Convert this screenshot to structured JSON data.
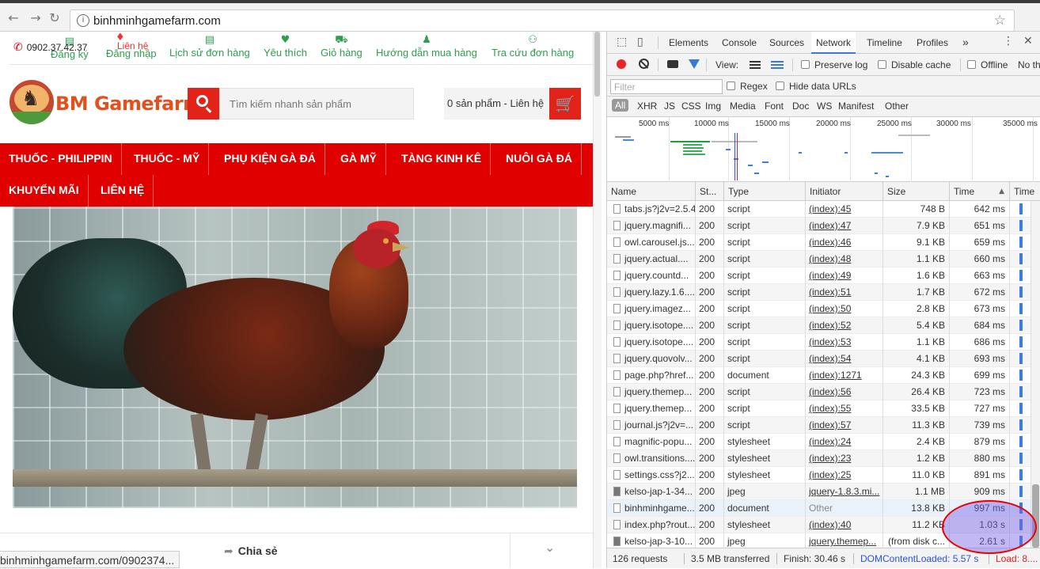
{
  "browser": {
    "url": "binhminhgamefarm.com",
    "status_url": "binhminhgamefarm.com/0902374..."
  },
  "site": {
    "phone": "0902.37.42.37",
    "top_links": [
      {
        "label": "Đăng ký",
        "icon": "file-icon"
      },
      {
        "label": "Liên hệ",
        "icon": "location-pin-icon"
      },
      {
        "label": "Đăng nhập",
        "icon": "login-icon"
      },
      {
        "label": "Lịch sử đơn hàng",
        "icon": "document-icon"
      },
      {
        "label": "Yêu thích",
        "icon": "heart-icon"
      },
      {
        "label": "Giỏ hàng",
        "icon": "cart-icon"
      },
      {
        "label": "Hướng dẫn mua hàng",
        "icon": "user-icon"
      },
      {
        "label": "Tra cứu đơn hàng",
        "icon": "binoculars-icon"
      }
    ],
    "logo_text": "BM Gamefarm",
    "search_placeholder": "Tìm kiếm nhanh sản phẩm",
    "cart_text": "0 sản phẩm - Liên hệ",
    "menu": [
      "THUỐC - PHILIPPIN",
      "THUỐC - MỸ",
      "PHỤ KIỆN GÀ ĐÁ",
      "GÀ MỸ",
      "TÀNG KINH KÊ",
      "NUÔI GÀ ĐÁ",
      "KHUYẾN MÃI",
      "LIÊN HỆ"
    ],
    "share_label": "Chia sẻ",
    "colors": {
      "brand_red": "#e00000",
      "accent_green": "#2e9e4d",
      "logo_orange": "#e2501e"
    }
  },
  "devtools": {
    "tabs": [
      "Elements",
      "Console",
      "Sources",
      "Network",
      "Timeline",
      "Profiles"
    ],
    "active_tab": "Network",
    "more": "»",
    "view_label": "View:",
    "preserve_log": "Preserve log",
    "disable_cache": "Disable cache",
    "offline": "Offline",
    "throttle": "No th",
    "filter_placeholder": "Filter",
    "regex": "Regex",
    "hide_data_urls": "Hide data URLs",
    "types": [
      "All",
      "XHR",
      "JS",
      "CSS",
      "Img",
      "Media",
      "Font",
      "Doc",
      "WS",
      "Manifest",
      "Other"
    ],
    "timeline_ticks": [
      "5000 ms",
      "10000 ms",
      "15000 ms",
      "20000 ms",
      "25000 ms",
      "30000 ms",
      "35000 ms"
    ],
    "columns": [
      "Name",
      "St...",
      "Type",
      "Initiator",
      "Size",
      "Time",
      "Time"
    ],
    "rows": [
      {
        "name": "tabs.js?j2v=2.5.4",
        "status": "200",
        "type": "script",
        "initiator": "(index):45",
        "size": "748 B",
        "time": "642 ms"
      },
      {
        "name": "jquery.magnifi...",
        "status": "200",
        "type": "script",
        "initiator": "(index):47",
        "size": "7.9 KB",
        "time": "651 ms"
      },
      {
        "name": "owl.carousel.js...",
        "status": "200",
        "type": "script",
        "initiator": "(index):46",
        "size": "9.1 KB",
        "time": "659 ms"
      },
      {
        "name": "jquery.actual....",
        "status": "200",
        "type": "script",
        "initiator": "(index):48",
        "size": "1.1 KB",
        "time": "660 ms"
      },
      {
        "name": "jquery.countd...",
        "status": "200",
        "type": "script",
        "initiator": "(index):49",
        "size": "1.6 KB",
        "time": "663 ms"
      },
      {
        "name": "jquery.lazy.1.6....",
        "status": "200",
        "type": "script",
        "initiator": "(index):51",
        "size": "1.7 KB",
        "time": "672 ms"
      },
      {
        "name": "jquery.imagez...",
        "status": "200",
        "type": "script",
        "initiator": "(index):50",
        "size": "2.8 KB",
        "time": "673 ms"
      },
      {
        "name": "jquery.isotope....",
        "status": "200",
        "type": "script",
        "initiator": "(index):52",
        "size": "5.4 KB",
        "time": "684 ms"
      },
      {
        "name": "jquery.isotope....",
        "status": "200",
        "type": "script",
        "initiator": "(index):53",
        "size": "1.1 KB",
        "time": "686 ms"
      },
      {
        "name": "jquery.quovolv...",
        "status": "200",
        "type": "script",
        "initiator": "(index):54",
        "size": "4.1 KB",
        "time": "693 ms"
      },
      {
        "name": "page.php?href...",
        "status": "200",
        "type": "document",
        "initiator": "(index):1271",
        "size": "24.3 KB",
        "time": "699 ms"
      },
      {
        "name": "jquery.themep...",
        "status": "200",
        "type": "script",
        "initiator": "(index):56",
        "size": "26.4 KB",
        "time": "723 ms"
      },
      {
        "name": "jquery.themep...",
        "status": "200",
        "type": "script",
        "initiator": "(index):55",
        "size": "33.5 KB",
        "time": "727 ms"
      },
      {
        "name": "journal.js?j2v=...",
        "status": "200",
        "type": "script",
        "initiator": "(index):57",
        "size": "11.3 KB",
        "time": "739 ms"
      },
      {
        "name": "magnific-popu...",
        "status": "200",
        "type": "stylesheet",
        "initiator": "(index):24",
        "size": "2.4 KB",
        "time": "879 ms"
      },
      {
        "name": "owl.transitions....",
        "status": "200",
        "type": "stylesheet",
        "initiator": "(index):23",
        "size": "1.2 KB",
        "time": "880 ms"
      },
      {
        "name": "settings.css?j2...",
        "status": "200",
        "type": "stylesheet",
        "initiator": "(index):25",
        "size": "11.0 KB",
        "time": "891 ms"
      },
      {
        "name": "kelso-jap-1-34...",
        "status": "200",
        "type": "jpeg",
        "initiator": "jquery-1.8.3.mi...",
        "size": "1.1 MB",
        "time": "909 ms"
      },
      {
        "name": "binhminhgame...",
        "status": "200",
        "type": "document",
        "initiator": "Other",
        "size": "13.8 KB",
        "time": "997 ms"
      },
      {
        "name": "index.php?rout...",
        "status": "200",
        "type": "stylesheet",
        "initiator": "(index):40",
        "size": "11.2 KB",
        "time": "1.03 s"
      },
      {
        "name": "kelso-jap-3-10...",
        "status": "200",
        "type": "jpeg",
        "initiator": "jquery.themep...",
        "size": "(from disk c...",
        "time": "2.61 s"
      }
    ],
    "summary": {
      "requests": "126 requests",
      "transferred": "3.5 MB transferred",
      "finish": "Finish: 30.46 s",
      "dcl": "DOMContentLoaded: 5.57 s",
      "load": "Load: 8...."
    },
    "colors": {
      "dcl_blue": "#2a53d6",
      "load_red": "#d22",
      "accent_blue": "#3879d9"
    }
  }
}
